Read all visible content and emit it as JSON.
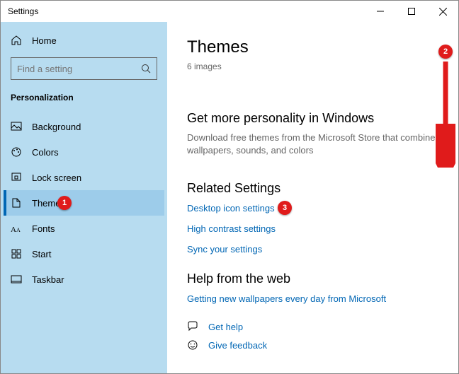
{
  "window": {
    "title": "Settings"
  },
  "sidebar": {
    "home": "Home",
    "search_placeholder": "Find a setting",
    "section": "Personalization",
    "items": [
      {
        "label": "Background"
      },
      {
        "label": "Colors"
      },
      {
        "label": "Lock screen"
      },
      {
        "label": "Themes"
      },
      {
        "label": "Fonts"
      },
      {
        "label": "Start"
      },
      {
        "label": "Taskbar"
      }
    ]
  },
  "content": {
    "title": "Themes",
    "subtitle": "6 images",
    "promo_heading": "Get more personality in Windows",
    "promo_desc": "Download free themes from the Microsoft Store that combine wallpapers, sounds, and colors",
    "related_heading": "Related Settings",
    "related_links": {
      "desktop_icons": "Desktop icon settings",
      "high_contrast": "High contrast settings",
      "sync": "Sync your settings"
    },
    "help_heading": "Help from the web",
    "help_link": "Getting new wallpapers every day from Microsoft",
    "get_help": "Get help",
    "give_feedback": "Give feedback"
  },
  "annotations": {
    "b1": "1",
    "b2": "2",
    "b3": "3"
  }
}
